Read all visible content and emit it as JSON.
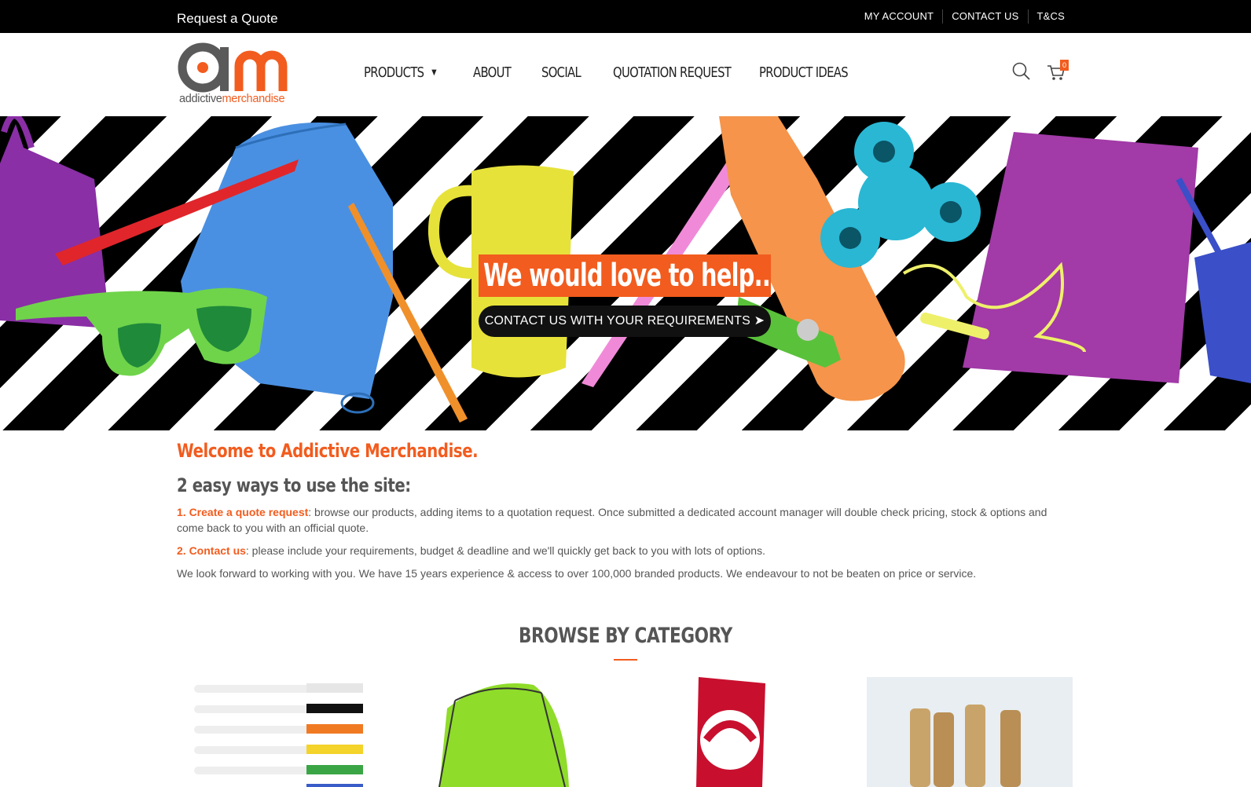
{
  "topbar": {
    "quote_link": "Request a Quote",
    "links": [
      "MY ACCOUNT",
      "CONTACT US",
      "T&CS"
    ]
  },
  "logo": {
    "wordmark_a": "addictive",
    "wordmark_b": "merchandise"
  },
  "nav": {
    "items": [
      "PRODUCTS",
      "ABOUT",
      "SOCIAL",
      "QUOTATION REQUEST",
      "PRODUCT IDEAS"
    ]
  },
  "header": {
    "cart_count": "0"
  },
  "hero": {
    "title": "We would love to help...",
    "cta": "CONTACT US WITH YOUR REQUIREMENTS ➤"
  },
  "intro": {
    "welcome": "Welcome to Addictive Merchandise.",
    "subhead": "2 easy ways to use the site:",
    "step1_label": "1. Create a quote request",
    "step1_text": ": browse our products, adding items to a quotation request. Once submitted a dedicated account manager will double check pricing, stock & options and come back to you with an official quote.",
    "step2_label": "2. Contact us",
    "step2_text": ": please include your requirements, budget & deadline and we'll quickly get back to you with lots of options.",
    "closing": "We look forward to working with you. We have 15 years experience & access to over 100,000 branded products. We endeavour to not be beaten on price or service."
  },
  "browse": {
    "heading": "BROWSE BY CATEGORY"
  },
  "colors": {
    "accent": "#f25c1e",
    "topbar": "#000000"
  }
}
